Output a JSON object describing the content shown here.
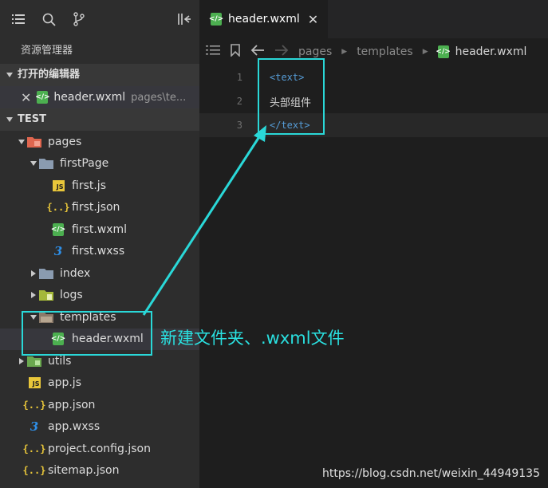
{
  "sidebar": {
    "title": "资源管理器",
    "open_editors": {
      "header": "打开的编辑器",
      "item_name": "header.wxml",
      "item_path": "pages\\te..."
    },
    "project": {
      "header": "TEST"
    },
    "tree": [
      {
        "label": "pages",
        "kind": "folder-pages",
        "depth": 0,
        "caret": "down"
      },
      {
        "label": "firstPage",
        "kind": "folder",
        "depth": 1,
        "caret": "down"
      },
      {
        "label": "first.js",
        "kind": "js",
        "depth": 2,
        "caret": ""
      },
      {
        "label": "first.json",
        "kind": "json",
        "depth": 2,
        "caret": ""
      },
      {
        "label": "first.wxml",
        "kind": "wxml",
        "depth": 2,
        "caret": ""
      },
      {
        "label": "first.wxss",
        "kind": "wxss",
        "depth": 2,
        "caret": ""
      },
      {
        "label": "index",
        "kind": "folder",
        "depth": 1,
        "caret": "right"
      },
      {
        "label": "logs",
        "kind": "folder-logs",
        "depth": 1,
        "caret": "right"
      },
      {
        "label": "templates",
        "kind": "folder-open",
        "depth": 1,
        "caret": "down"
      },
      {
        "label": "header.wxml",
        "kind": "wxml",
        "depth": 2,
        "caret": "",
        "selected": true
      },
      {
        "label": "utils",
        "kind": "folder-utils",
        "depth": 0,
        "caret": "right"
      },
      {
        "label": "app.js",
        "kind": "js",
        "depth": 0,
        "caret": ""
      },
      {
        "label": "app.json",
        "kind": "json",
        "depth": 0,
        "caret": ""
      },
      {
        "label": "app.wxss",
        "kind": "wxss",
        "depth": 0,
        "caret": ""
      },
      {
        "label": "project.config.json",
        "kind": "json",
        "depth": 0,
        "caret": ""
      },
      {
        "label": "sitemap.json",
        "kind": "json",
        "depth": 0,
        "caret": ""
      }
    ]
  },
  "editor": {
    "tab_label": "header.wxml",
    "breadcrumb": [
      "pages",
      "templates",
      "header.wxml"
    ],
    "lines": [
      {
        "no": "1",
        "text": "<text>",
        "kind": "tag"
      },
      {
        "no": "2",
        "text": "头部组件",
        "kind": "plain"
      },
      {
        "no": "3",
        "text": "</text>",
        "kind": "tag"
      }
    ]
  },
  "annotation": {
    "label": "新建文件夹、.wxml文件",
    "color": "#2ad8d8"
  },
  "watermark": "https://blog.csdn.net/weixin_44949135"
}
